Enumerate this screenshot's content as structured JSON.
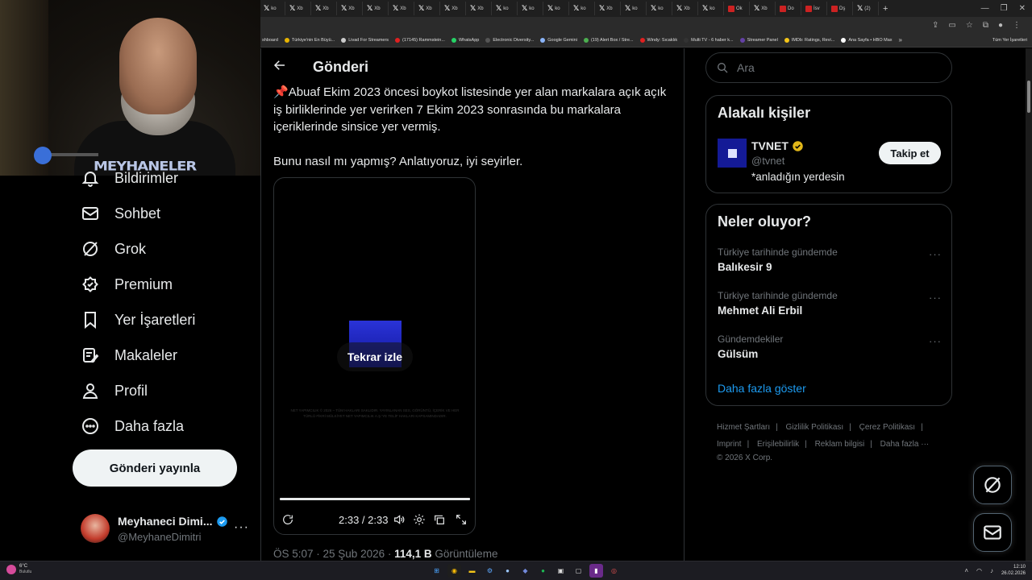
{
  "browser": {
    "tabs": [
      {
        "icon": "x",
        "label": "ko"
      },
      {
        "icon": "x",
        "label": "Xb"
      },
      {
        "icon": "x",
        "label": "Xb"
      },
      {
        "icon": "x",
        "label": "Xb"
      },
      {
        "icon": "x",
        "label": "Xb"
      },
      {
        "icon": "x",
        "label": "Xb"
      },
      {
        "icon": "x",
        "label": "Xb"
      },
      {
        "icon": "x",
        "label": "Xb"
      },
      {
        "icon": "x",
        "label": "Xb"
      },
      {
        "icon": "x",
        "label": "ko"
      },
      {
        "icon": "x",
        "label": "ko"
      },
      {
        "icon": "x",
        "label": "ko"
      },
      {
        "icon": "x",
        "label": "ko"
      },
      {
        "icon": "x",
        "label": "Xb"
      },
      {
        "icon": "x",
        "label": "ko"
      },
      {
        "icon": "x",
        "label": "ko"
      },
      {
        "icon": "x",
        "label": "Xb"
      },
      {
        "icon": "x",
        "label": "ko"
      },
      {
        "icon": "red",
        "label": "Ok"
      },
      {
        "icon": "x",
        "label": "Xb"
      },
      {
        "icon": "red",
        "label": "Do"
      },
      {
        "icon": "red",
        "label": "İsv"
      },
      {
        "icon": "red",
        "label": "Dş"
      },
      {
        "icon": "x",
        "label": "(2)"
      }
    ],
    "bookmarks": [
      {
        "label": "shboard",
        "color": ""
      },
      {
        "label": "Türkiye'nin En Büyü...",
        "color": "#e8b400"
      },
      {
        "label": "Livad For Streamers",
        "color": "#ccc"
      },
      {
        "label": "(17145) Rammstein...",
        "color": "#e02020"
      },
      {
        "label": "WhatsApp",
        "color": "#25d366"
      },
      {
        "label": "Electronic Diversity...",
        "color": "#555"
      },
      {
        "label": "Google Gemini",
        "color": "#8ab4f8"
      },
      {
        "label": "(19) Alert Box / Stre...",
        "color": "#4caf50"
      },
      {
        "label": "Windy: Sıcaklık",
        "color": "#e02020"
      },
      {
        "label": "Multi TV - 6 haber k...",
        "color": "#333"
      },
      {
        "label": "Streamer Panel",
        "color": "#6441a5"
      },
      {
        "label": "IMDb: Ratings, Revi...",
        "color": "#f5c518"
      },
      {
        "label": "Ana Sayfa • HBO Max",
        "color": "#fff"
      }
    ],
    "bookmarks_more": "»",
    "bookmarks_all": "Tüm Yer İşaretleri"
  },
  "webcam": {
    "shirt_text": "MEYHANELER"
  },
  "nav": {
    "items": [
      {
        "label": "Bildirimler",
        "icon": "bell-icon"
      },
      {
        "label": "Sohbet",
        "icon": "mail-icon"
      },
      {
        "label": "Grok",
        "icon": "grok-icon"
      },
      {
        "label": "Premium",
        "icon": "premium-badge-icon"
      },
      {
        "label": "Yer İşaretleri",
        "icon": "bookmark-icon"
      },
      {
        "label": "Makaleler",
        "icon": "article-icon"
      },
      {
        "label": "Profil",
        "icon": "person-icon"
      },
      {
        "label": "Daha fazla",
        "icon": "more-circle-icon"
      }
    ],
    "post_button": "Gönderi yayınla",
    "account": {
      "name": "Meyhaneci Dimi...",
      "handle": "@MeyhaneDimitri",
      "more": "···"
    }
  },
  "main": {
    "title": "Gönderi",
    "post_pin": "📌",
    "post_paragraph_1": "Abuaf Ekim 2023 öncesi boykot listesinde yer alan markalara açık açık iş birliklerinde yer verirken 7 Ekim 2023 sonrasında bu markalara içeriklerinde sinsice yer vermiş.",
    "post_paragraph_2": "Bunu nasıl mı yapmış? Anlatıyoruz, iyi seyirler.",
    "video": {
      "replay_label": "Tekrar izle",
      "legal_text": "NET YAPIMCILIK © 2026 – TÜM HAKLARI SAKLIDIR. YAYINLANAN SES, GÖRÜNTÜ, İÇERİK VE HER TÜRLÜ FİKRİ MÜLKİYET NET YAPIMCILIK A.Ş.'YE TELİF HAKLARI KAPSAMINDADIR.",
      "time": "2:33 / 2:33",
      "progress": 1.0
    },
    "meta_time": "ÖS 5:07 · 25 Şub 2026 · ",
    "meta_views_count": "114,1 B",
    "meta_views_label": " Görüntüleme"
  },
  "right": {
    "search_placeholder": "Ara",
    "people": {
      "heading": "Alakalı kişiler",
      "name": "TVNET",
      "handle": "@tvnet",
      "bio": "*anladığın yerdesin",
      "follow_label": "Takip et"
    },
    "trends": {
      "heading": "Neler oluyor?",
      "items": [
        {
          "context": "Türkiye tarihinde gündemde",
          "title": "Balıkesir 9"
        },
        {
          "context": "Türkiye tarihinde gündemde",
          "title": "Mehmet Ali Erbil"
        },
        {
          "context": "Gündemdekiler",
          "title": "Gülsüm"
        }
      ],
      "more_dots": "···",
      "show_more": "Daha fazla göster"
    },
    "footer": {
      "terms": "Hizmet Şartları",
      "privacy": "Gizlilik Politikası",
      "cookies": "Çerez Politikası",
      "imprint": "Imprint",
      "accessibility": "Erişilebilirlik",
      "ads": "Reklam bilgisi",
      "more": "Daha fazla ···",
      "copyright": "© 2026 X Corp."
    }
  },
  "taskbar": {
    "weather_temp": "6°C",
    "weather_desc": "Bulutlu",
    "time": "12:10",
    "date": "26.02.2026"
  },
  "colors": {
    "accent": "#1d9bf0",
    "verified_gold": "#e2b719",
    "background": "#000000"
  }
}
